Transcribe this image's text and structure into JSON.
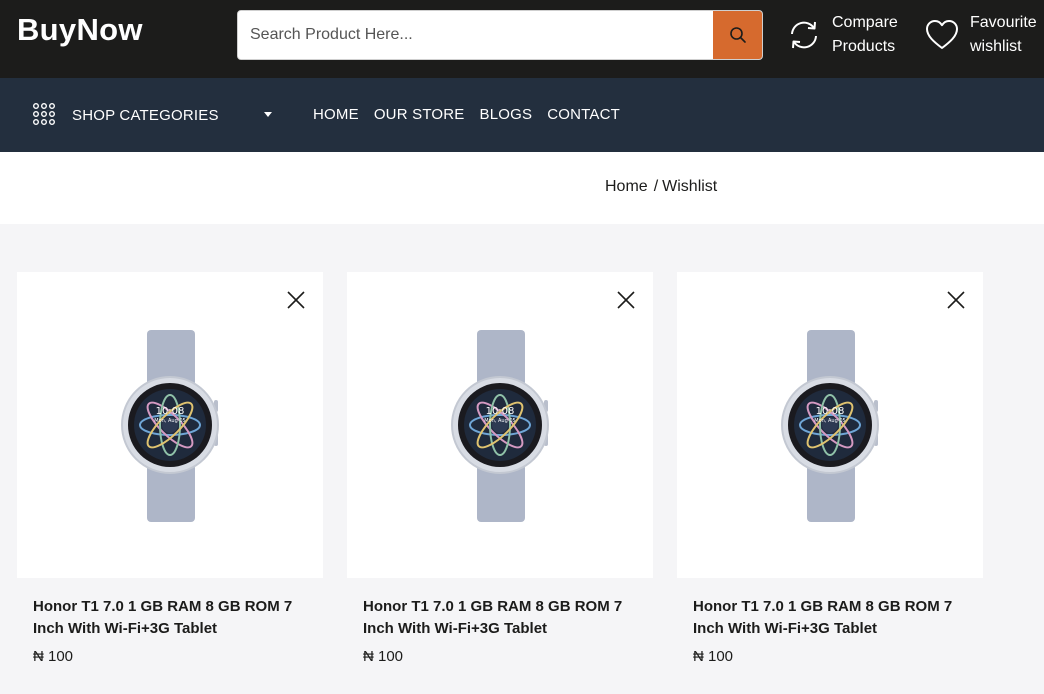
{
  "header": {
    "logo": "BuyNow",
    "search_placeholder": "Search Product Here...",
    "compare_line1": "Compare",
    "compare_line2": "Products",
    "wish_line1": "Favourite",
    "wish_line2": "wishlist",
    "accent_color": "#d66a2e"
  },
  "nav": {
    "categories_label": "SHOP CATEGORIES",
    "items": [
      "HOME",
      "OUR STORE",
      "BLOGS",
      "CONTACT"
    ]
  },
  "breadcrumb": {
    "home": "Home",
    "separator": "/",
    "current": "Wishlist"
  },
  "products": [
    {
      "title_line1": "Honor T1 7.0 1 GB RAM 8 GB ROM 7",
      "title_line2": "Inch With Wi-Fi+3G Tablet",
      "price": "₦ 100",
      "watch_time": "10:08",
      "watch_date": "Mon, Aug 05"
    },
    {
      "title_line1": "Honor T1 7.0 1 GB RAM 8 GB ROM 7",
      "title_line2": "Inch With Wi-Fi+3G Tablet",
      "price": "₦ 100",
      "watch_time": "10:08",
      "watch_date": "Mon, Aug 05"
    },
    {
      "title_line1": "Honor T1 7.0 1 GB RAM 8 GB ROM 7",
      "title_line2": "Inch With Wi-Fi+3G Tablet",
      "price": "₦ 100",
      "watch_time": "10:08",
      "watch_date": "Mon, Aug 05"
    }
  ]
}
